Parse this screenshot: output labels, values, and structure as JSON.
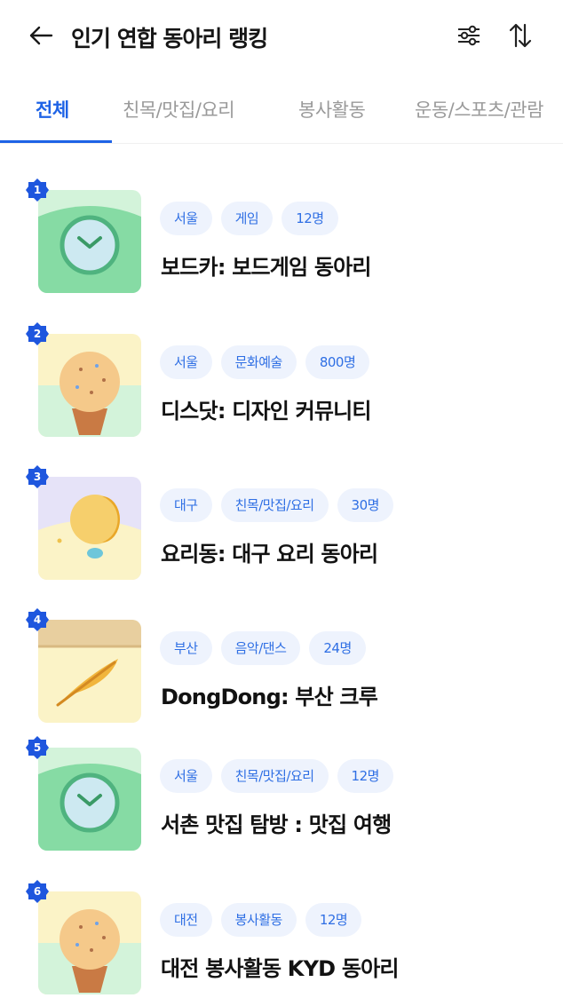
{
  "header": {
    "title": "인기 연합 동아리 랭킹",
    "back_icon": "arrow-left-icon",
    "filter_icon": "sliders-icon",
    "sort_icon": "sort-arrows-icon"
  },
  "tabs": [
    {
      "label": "전체",
      "active": true
    },
    {
      "label": "친목/맛집/요리",
      "active": false
    },
    {
      "label": "봉사활동",
      "active": false
    },
    {
      "label": "운동/스포츠/관람",
      "active": false
    }
  ],
  "colors": {
    "accent": "#1e63e6",
    "tag_bg": "#eef3fd",
    "tag_text": "#2f6fe4",
    "inactive_tab": "#9a9a9a"
  },
  "clubs": [
    {
      "rank": "1",
      "tags": [
        "서울",
        "게임",
        "12명"
      ],
      "name": "보드카: 보드게임 동아리",
      "thumbnail": "clock-illustration"
    },
    {
      "rank": "2",
      "tags": [
        "서울",
        "문화예술",
        "800명"
      ],
      "name": "디스닷: 디자인 커뮤니티",
      "thumbnail": "ice-cream-illustration"
    },
    {
      "rank": "3",
      "tags": [
        "대구",
        "친목/맛집/요리",
        "30명"
      ],
      "name": "요리동: 대구 요리 동아리",
      "thumbnail": "moon-illustration"
    },
    {
      "rank": "4",
      "tags": [
        "부산",
        "음악/댄스",
        "24명"
      ],
      "name": "DongDong: 부산 크루",
      "thumbnail": "leaf-folder-illustration"
    },
    {
      "rank": "5",
      "tags": [
        "서울",
        "친목/맛집/요리",
        "12명"
      ],
      "name": "서촌 맛집 탐방 : 맛집 여행",
      "thumbnail": "clock-illustration"
    },
    {
      "rank": "6",
      "tags": [
        "대전",
        "봉사활동",
        "12명"
      ],
      "name": "대전 봉사활동 KYD 동아리",
      "thumbnail": "ice-cream-illustration"
    }
  ]
}
